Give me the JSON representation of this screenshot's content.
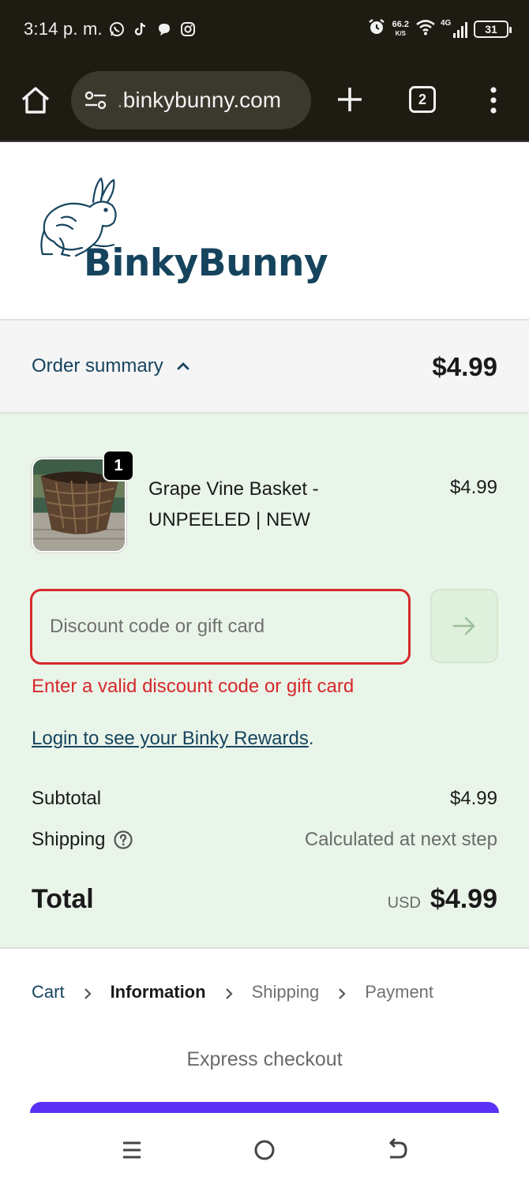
{
  "status_bar": {
    "time": "3:14 p. m.",
    "net_speed": "66.2",
    "net_unit": "K/S",
    "network": "4G",
    "battery": "31"
  },
  "browser": {
    "url_prefix": "",
    "url": "binkybunny.com",
    "tab_count": "2"
  },
  "brand": {
    "name": "BinkyBunny",
    "color": "#16445e"
  },
  "order_summary": {
    "toggle_label": "Order summary",
    "total": "$4.99",
    "item": {
      "name": "Grape Vine Basket - UNPEELED | NEW",
      "price": "$4.99",
      "quantity": "1"
    },
    "discount": {
      "placeholder": "Discount code or gift card",
      "value": "",
      "error": "Enter a valid discount code or gift card"
    },
    "rewards_link": "Login to see your Binky Rewards",
    "rewards_suffix": ".",
    "subtotal_label": "Subtotal",
    "subtotal_value": "$4.99",
    "shipping_label": "Shipping",
    "shipping_value": "Calculated at next step",
    "total_label": "Total",
    "currency": "USD",
    "total_value": "$4.99"
  },
  "breadcrumbs": [
    {
      "label": "Cart",
      "state": "link"
    },
    {
      "label": "Information",
      "state": "current"
    },
    {
      "label": "Shipping",
      "state": "upcoming"
    },
    {
      "label": "Payment",
      "state": "upcoming"
    }
  ],
  "express_checkout": "Express checkout",
  "colors": {
    "summary_bg": "#eaf5e9",
    "error": "#d6282b",
    "pay_button": "#5a31f4"
  }
}
